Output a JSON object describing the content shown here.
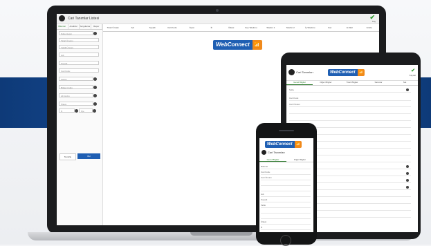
{
  "brand": {
    "logo_text": "WebConnect",
    "badge_color": "#f08a1c",
    "primary_color": "#1f5fb3"
  },
  "laptop": {
    "window_title": "Cari Tanımlar Listesi",
    "save_label": "Kay",
    "sidebar_tabs": [
      "Bilemler",
      "Analizler",
      "Sorgulama",
      "Rapor"
    ],
    "fields": [
      {
        "label": "Şube",
        "value": "Hepsi"
      },
      {
        "label": "Ticari Ünvanı",
        "value": ""
      },
      {
        "label": "Yetkili Ünvanı",
        "value": ""
      },
      {
        "label": "Adı",
        "value": ""
      },
      {
        "label": "Soyadı",
        "value": ""
      },
      {
        "label": "Cari Kodu",
        "value": ""
      },
      {
        "label": "Sektör",
        "value": ""
      },
      {
        "label": "Bölge Grubu",
        "value": ""
      },
      {
        "label": "Alt Grubu",
        "value": ""
      },
      {
        "label": "Ülkesi",
        "value": ""
      },
      {
        "label": "İli",
        "value": "İlçe"
      }
    ],
    "clear_button": "Temizle",
    "search_button": "Bul",
    "columns": [
      "Ticari Ünvanı",
      "Adı",
      "Soyadı",
      "Cari Kodu",
      "İlçesi",
      "İli",
      "Ülkesi",
      "Cep Telefonu",
      "Telefon 1",
      "Telefon 2",
      "İş Telefonu",
      "Fax",
      "E-Mail",
      "Grubu"
    ]
  },
  "tablet": {
    "title": "Cari Tanımları",
    "save_label": "Kaydet",
    "tabs": [
      "Genel Bilgiler",
      "Diğer Bilgiler",
      "Ticari Bilgiler",
      "Satıcılar",
      "Sat"
    ],
    "rows": [
      "Şube",
      "Cari Kodu",
      "Cari Ünvanı"
    ]
  },
  "phone": {
    "title": "Cari Tanımları",
    "tabs": [
      "Genel Bilgiler",
      "Diğer Bilgiler"
    ],
    "rows": [
      "Bölümü",
      "Cari Kodu",
      "Cari Ünvanı",
      "",
      "",
      "Adı",
      "Soyadı",
      "Tablo",
      "",
      "",
      "Ülkesi",
      "İli"
    ]
  }
}
